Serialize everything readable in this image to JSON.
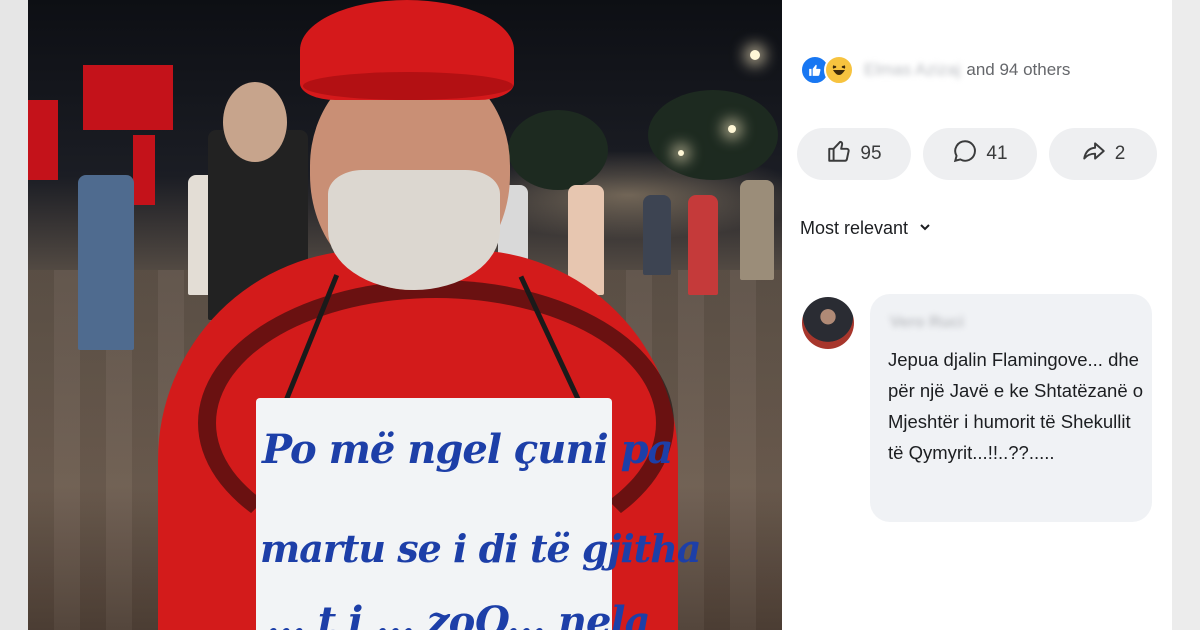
{
  "photo": {
    "sign_lines": [
      "Po më ngel çuni pa",
      "martu se i di të gjitha",
      "... t i ... zoQ... nela"
    ]
  },
  "post": {
    "reactions": {
      "icons": [
        "like-icon",
        "haha-icon"
      ],
      "name": "Elmas Azizaj",
      "others": "and 94 others"
    },
    "actions": {
      "like_count": "95",
      "comment_count": "41",
      "share_count": "2"
    },
    "sort_label": "Most relevant",
    "comment": {
      "author": "Vero Ruci",
      "text": "Jepua djalin Flamingove... dhe për një Javë e ke Shtatëzanë o Mjeshtër i humorit të Shekullit të Qymyrit...!!..??....."
    },
    "colors": {
      "brand_blue": "#1877f2",
      "haha_yellow": "#f7c33f",
      "pill_bg": "#eeeff1",
      "bubble_bg": "#f0f2f5"
    }
  }
}
